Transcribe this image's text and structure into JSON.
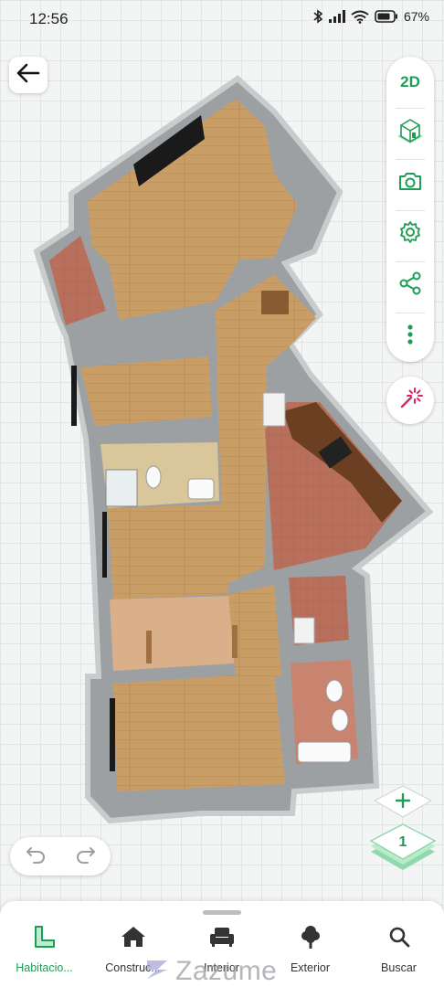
{
  "status_bar": {
    "time": "12:56",
    "battery": "67%"
  },
  "toolbar": {
    "view_2d_label": "2D",
    "tools": [
      "3d-view-icon",
      "camera-icon",
      "settings-icon",
      "share-icon",
      "more-icon"
    ],
    "magic_icon": "sparkle-icon"
  },
  "levels": {
    "current": "1"
  },
  "bottom_nav": {
    "items": [
      {
        "label": "Habitacio...",
        "icon": "room-outline-icon",
        "active": true
      },
      {
        "label": "Construc...",
        "icon": "house-icon",
        "active": false
      },
      {
        "label": "Interior",
        "icon": "armchair-icon",
        "active": false
      },
      {
        "label": "Exterior",
        "icon": "tree-icon",
        "active": false
      },
      {
        "label": "Buscar",
        "icon": "search-icon",
        "active": false
      }
    ]
  },
  "watermark": {
    "text": "Zazume"
  },
  "colors": {
    "accent": "#1f9d55",
    "wall": "#9a9d9f",
    "wood_floor": "#c9a06a",
    "tile_floor": "#b66f5c"
  }
}
